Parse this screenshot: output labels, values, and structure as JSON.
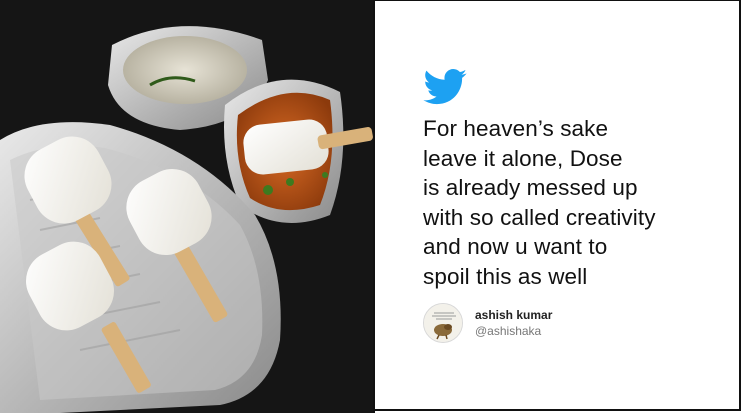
{
  "photo": {
    "description_icon": "idli-popsicles-photo"
  },
  "tweet": {
    "logo_icon": "twitter-bird-icon",
    "brand_color": "#1da1f2",
    "text_lines": [
      "For heaven’s sake",
      "leave it alone, Dose",
      "is already messed up",
      "with so called creativity",
      "and now u want to",
      "spoil this as well"
    ],
    "author": {
      "name": "ashish kumar",
      "handle": "@ashishaka",
      "avatar_icon": "avatar-image"
    }
  }
}
